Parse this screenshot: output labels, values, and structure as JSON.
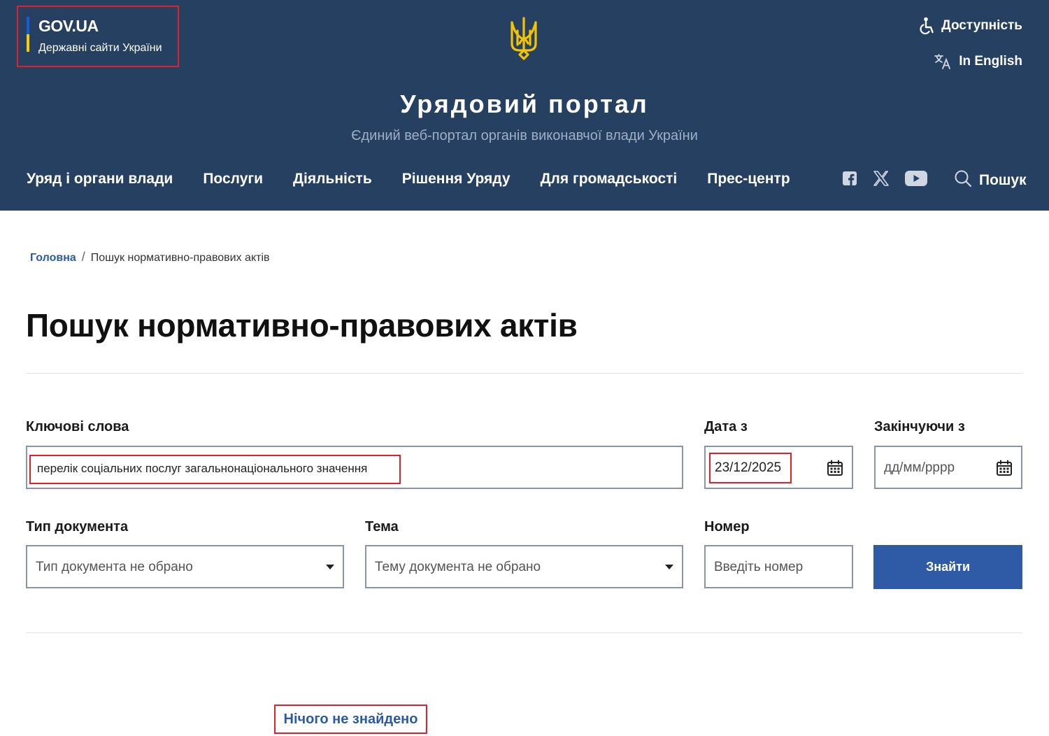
{
  "header": {
    "govua_title": "GOV.UA",
    "govua_subtitle": "Державні сайти України",
    "accessibility_label": "Доступність",
    "language_label": "In English",
    "portal_title": "Урядовий портал",
    "portal_subtitle": "Єдиний веб-портал органів виконавчої влади України",
    "nav": [
      {
        "label": "Уряд і органи влади"
      },
      {
        "label": "Послуги"
      },
      {
        "label": "Діяльність"
      },
      {
        "label": "Рішення Уряду"
      },
      {
        "label": "Для громадськості"
      },
      {
        "label": "Прес-центр"
      }
    ],
    "social": [
      "facebook-icon",
      "x-twitter-icon",
      "youtube-icon"
    ],
    "search_label": "Пошук",
    "colors": {
      "background": "#254060",
      "flag_blue": "#1a5cd6",
      "flag_yellow": "#f5d000",
      "trident": "#f5c400"
    }
  },
  "breadcrumb": {
    "home": "Головна",
    "separator": "/",
    "current": "Пошук нормативно-правових актів"
  },
  "page": {
    "title": "Пошук нормативно-правових актів"
  },
  "form": {
    "keywords_label": "Ключові слова",
    "keywords_value": "перелік соціальних послуг загальнонаціонального значення",
    "date_from_label": "Дата з",
    "date_from_value": "23/12/2025",
    "date_to_label": "Закінчуючи з",
    "date_to_placeholder": "дд/мм/рррр",
    "doc_type_label": "Тип документа",
    "doc_type_value": "Тип документа не обрано",
    "topic_label": "Тема",
    "topic_value": "Тему документа не обрано",
    "number_label": "Номер",
    "number_placeholder": "Введіть номер",
    "submit_label": "Знайти",
    "colors": {
      "button": "#2e5aa6",
      "highlight": "#e0202a"
    }
  },
  "results": {
    "message": "Нічого не знайдено"
  }
}
